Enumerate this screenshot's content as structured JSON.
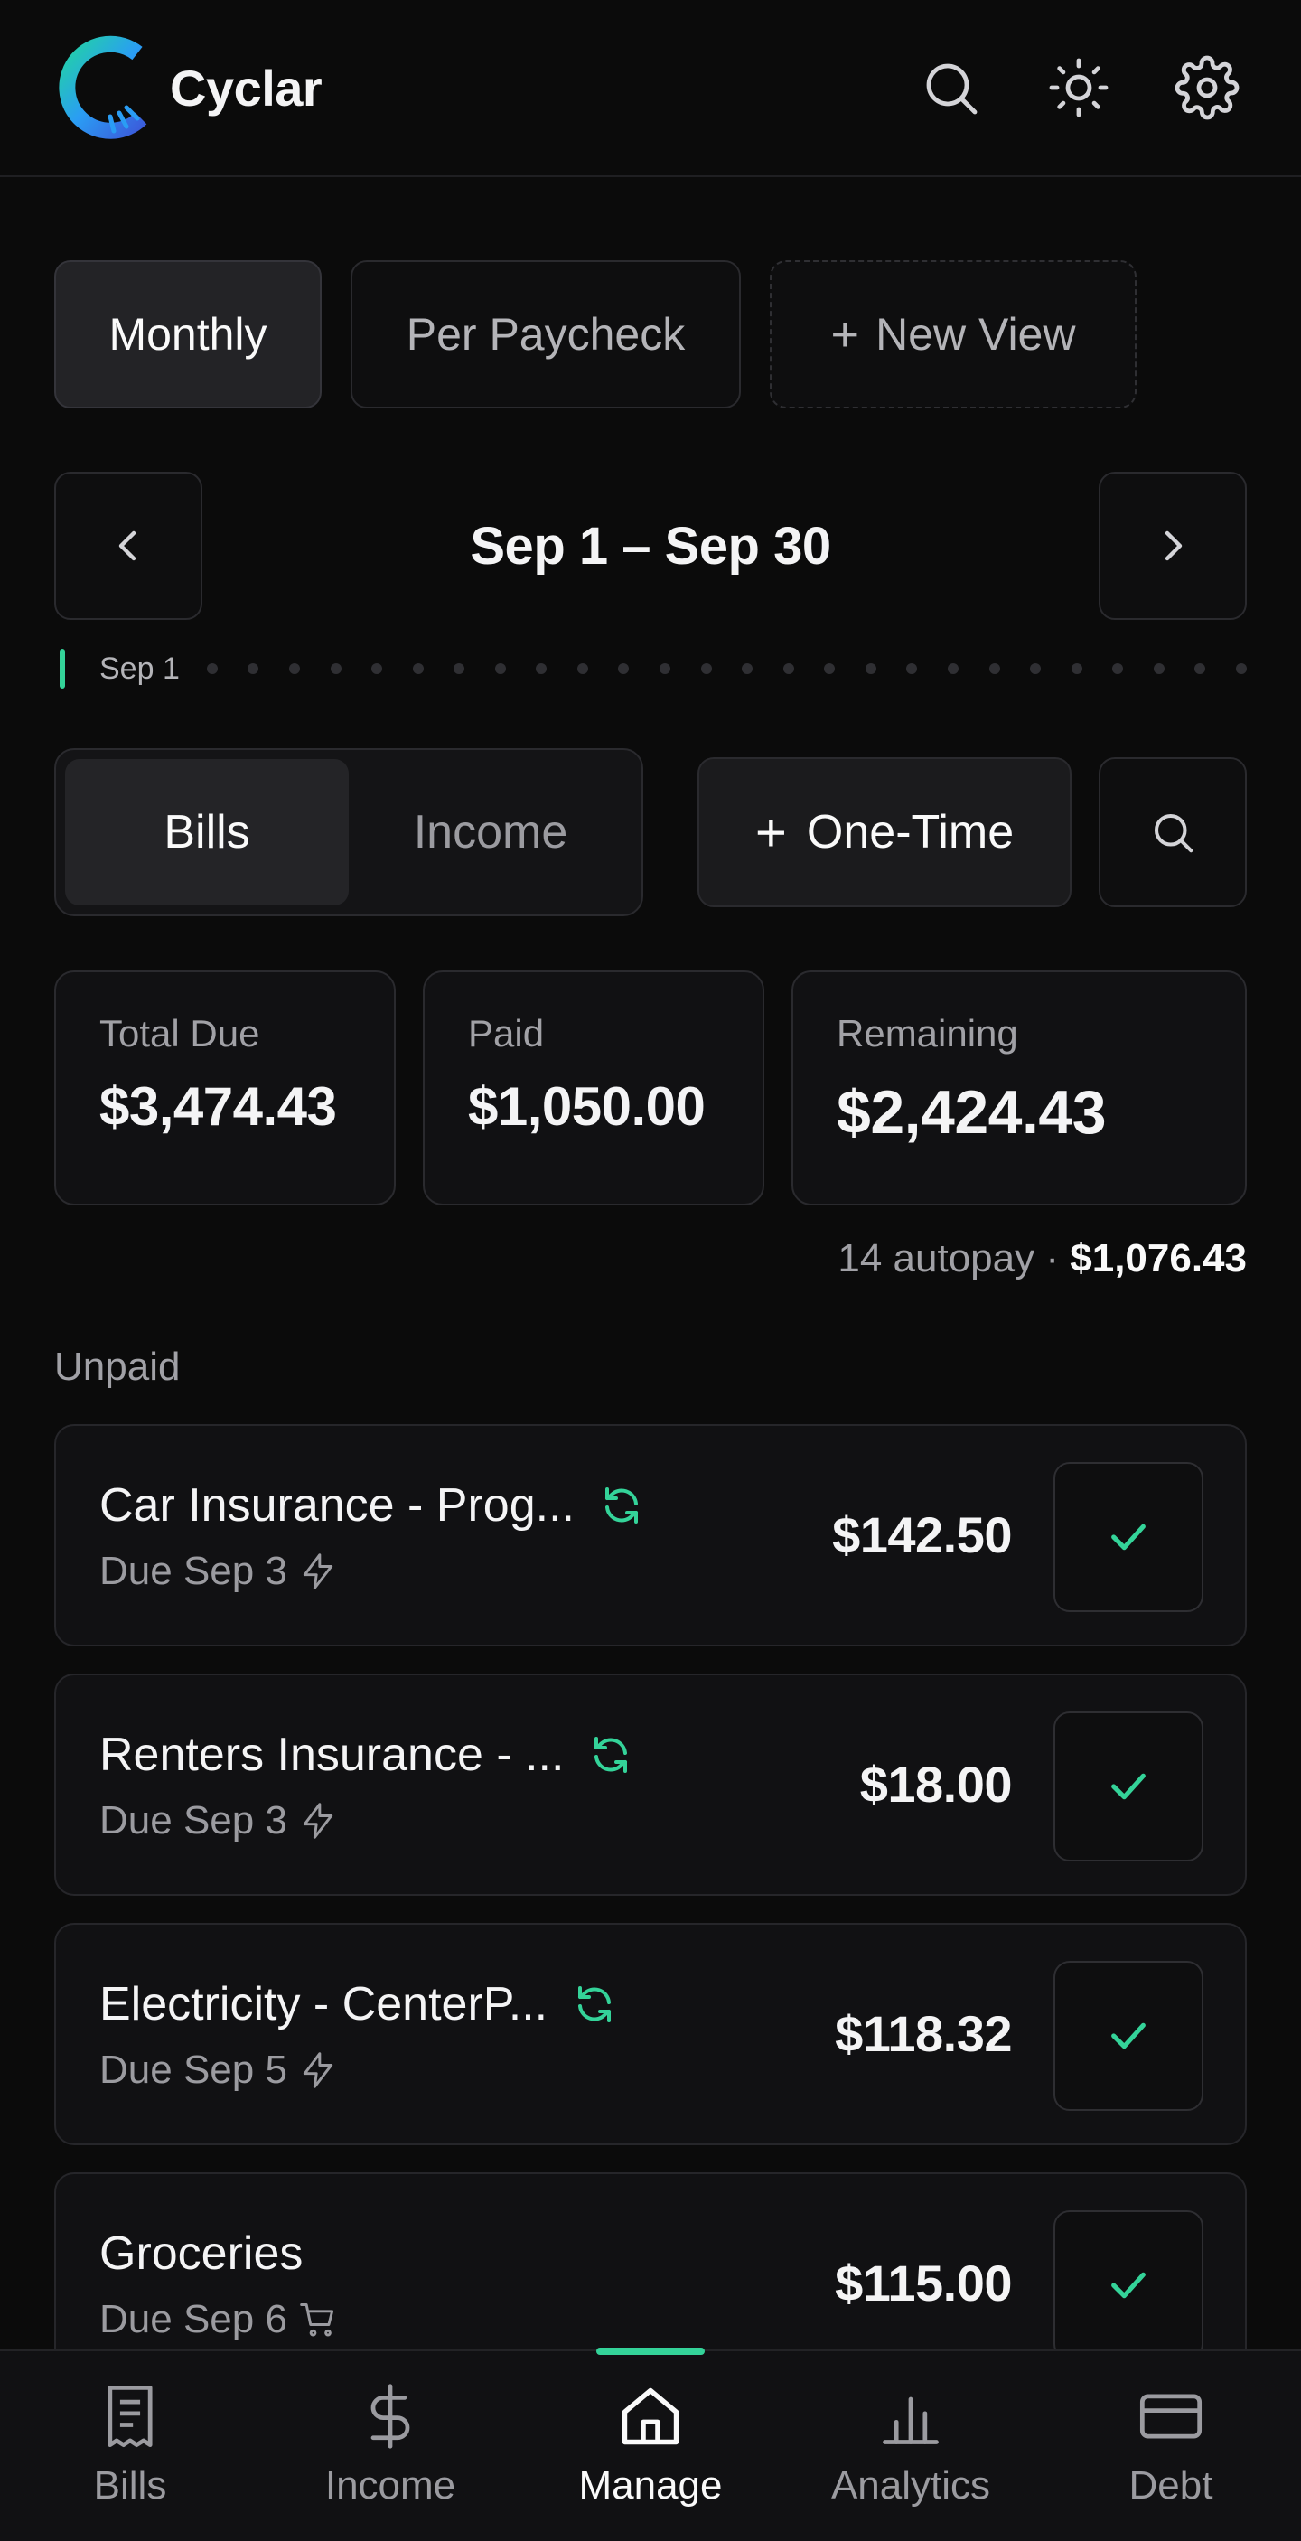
{
  "app": {
    "name": "Cyclar"
  },
  "colors": {
    "accent": "#34d399",
    "background": "#0b0b0b",
    "card": "#111113"
  },
  "header": {
    "icons": [
      "search-icon",
      "sun-icon",
      "gear-icon"
    ]
  },
  "views": {
    "monthly": "Monthly",
    "per_paycheck": "Per Paycheck",
    "new_view": "New View"
  },
  "date_nav": {
    "range": "Sep 1 – Sep 30",
    "timeline_start": "Sep 1"
  },
  "toggle": {
    "bills": "Bills",
    "income": "Income"
  },
  "actions": {
    "one_time": "One-Time"
  },
  "summary": {
    "total_due_label": "Total Due",
    "total_due": "$3,474.43",
    "paid_label": "Paid",
    "paid": "$1,050.00",
    "remaining_label": "Remaining",
    "remaining": "$2,424.43",
    "autopay_count": "14 autopay",
    "autopay_sep": "·",
    "autopay_amount": "$1,076.43"
  },
  "section": {
    "unpaid": "Unpaid"
  },
  "bills": [
    {
      "name": "Car Insurance - Prog...",
      "due": "Due Sep 3",
      "amount": "$142.50",
      "due_icon": "bolt-icon",
      "recurring": true
    },
    {
      "name": "Renters Insurance - ...",
      "due": "Due Sep 3",
      "amount": "$18.00",
      "due_icon": "bolt-icon",
      "recurring": true
    },
    {
      "name": "Electricity - CenterP...",
      "due": "Due Sep 5",
      "amount": "$118.32",
      "due_icon": "bolt-icon",
      "recurring": true
    },
    {
      "name": "Groceries",
      "due": "Due Sep 6",
      "amount": "$115.00",
      "due_icon": "cart-icon",
      "recurring": false
    }
  ],
  "bottom_nav": {
    "bills": "Bills",
    "income": "Income",
    "manage": "Manage",
    "analytics": "Analytics",
    "debt": "Debt",
    "active": "Manage"
  }
}
